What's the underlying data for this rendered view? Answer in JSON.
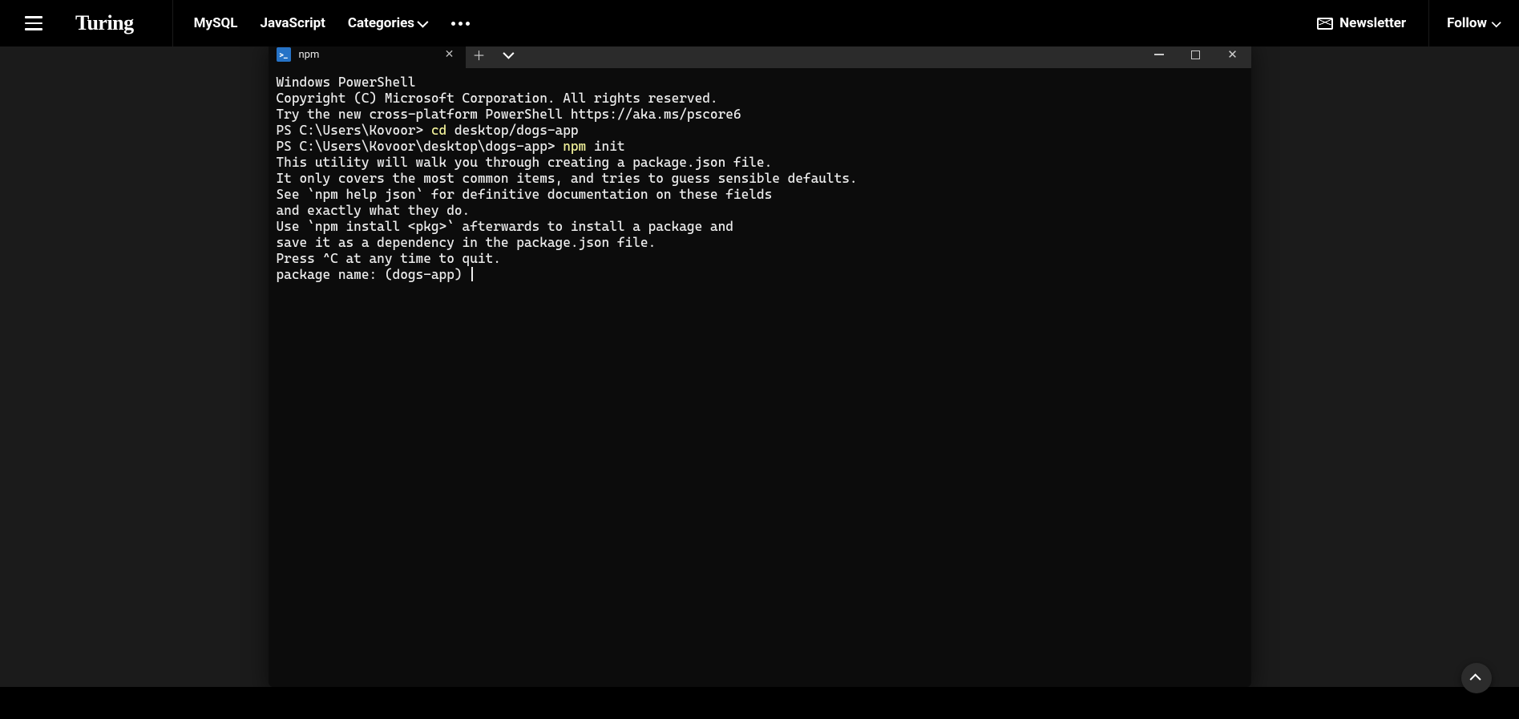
{
  "header": {
    "logo": "Turing",
    "links": [
      "MySQL",
      "JavaScript"
    ],
    "categories_label": "Categories",
    "newsletter_label": "Newsletter",
    "follow_label": "Follow"
  },
  "terminal": {
    "tab_icon_glyph": ">_",
    "tab_title": "npm",
    "lines": [
      {
        "segments": [
          {
            "t": "Windows PowerShell"
          }
        ]
      },
      {
        "segments": [
          {
            "t": "Copyright (C) Microsoft Corporation. All rights reserved."
          }
        ]
      },
      {
        "segments": [
          {
            "t": ""
          }
        ]
      },
      {
        "segments": [
          {
            "t": "Try the new cross-platform PowerShell https://aka.ms/pscore6"
          }
        ]
      },
      {
        "segments": [
          {
            "t": ""
          }
        ]
      },
      {
        "segments": [
          {
            "t": "PS C:\\Users\\Kovoor> "
          },
          {
            "t": "cd ",
            "c": "yellow"
          },
          {
            "t": "desktop/dogs-app"
          }
        ]
      },
      {
        "segments": [
          {
            "t": "PS C:\\Users\\Kovoor\\desktop\\dogs-app> "
          },
          {
            "t": "npm ",
            "c": "yellow"
          },
          {
            "t": "init"
          }
        ]
      },
      {
        "segments": [
          {
            "t": "This utility will walk you through creating a package.json file."
          }
        ]
      },
      {
        "segments": [
          {
            "t": "It only covers the most common items, and tries to guess sensible defaults."
          }
        ]
      },
      {
        "segments": [
          {
            "t": ""
          }
        ]
      },
      {
        "segments": [
          {
            "t": "See `npm help json` for definitive documentation on these fields"
          }
        ]
      },
      {
        "segments": [
          {
            "t": "and exactly what they do."
          }
        ]
      },
      {
        "segments": [
          {
            "t": ""
          }
        ]
      },
      {
        "segments": [
          {
            "t": "Use `npm install <pkg>` afterwards to install a package and"
          }
        ]
      },
      {
        "segments": [
          {
            "t": "save it as a dependency in the package.json file."
          }
        ]
      },
      {
        "segments": [
          {
            "t": ""
          }
        ]
      },
      {
        "segments": [
          {
            "t": "Press ^C at any time to quit."
          }
        ]
      },
      {
        "segments": [
          {
            "t": "package name: (dogs-app) "
          }
        ],
        "cursor": true
      }
    ]
  }
}
